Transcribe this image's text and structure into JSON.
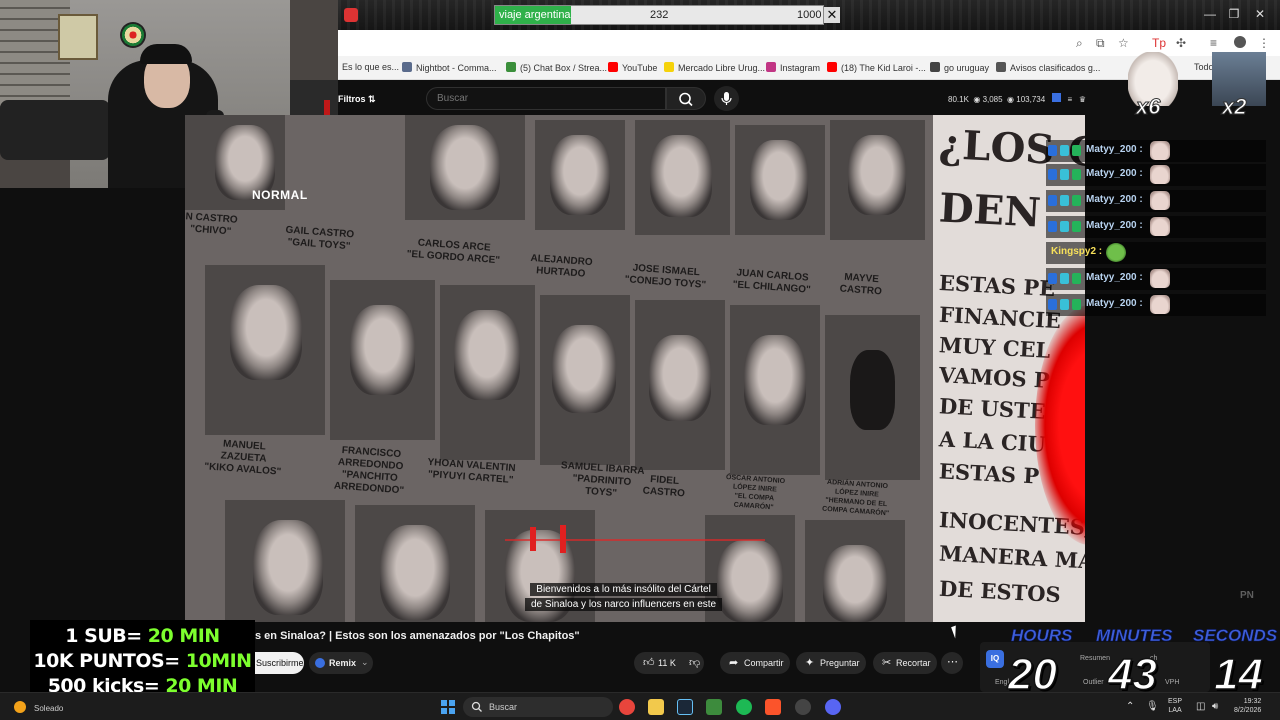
{
  "stream_goal": {
    "title": "viaje argentina",
    "current": "232",
    "target": "1000",
    "progress": 0.232
  },
  "browser": {
    "bookmarks": [
      {
        "label": "Es lo que es...",
        "color": "#888888"
      },
      {
        "label": "Nightbot - Comma...",
        "color": "#5a6b8c"
      },
      {
        "label": "(5) Chat Box / Strea...",
        "color": "#3b8f3b"
      },
      {
        "label": "YouTube",
        "color": "#ff0000"
      },
      {
        "label": "Mercado Libre Urug...",
        "color": "#f5d20a"
      },
      {
        "label": "Instagram",
        "color": "#c13584"
      },
      {
        "label": "(18) The Kid Laroi -...",
        "color": "#ff0000"
      },
      {
        "label": "go uruguay",
        "color": "#444444"
      },
      {
        "label": "Avisos clasificados g...",
        "color": "#555555"
      },
      {
        "label": "Todo",
        "color": "#777777"
      }
    ]
  },
  "youtube": {
    "filters_label": "Filtros",
    "search_placeholder": "Buscar",
    "stats": {
      "views": "80.1K",
      "watching": "3,085",
      "total": "103,734"
    },
    "subtitles": [
      "Bienvenidos a lo más insólito del Cártel",
      "de Sinaloa y los narco influencers en este"
    ],
    "watermark": "PN",
    "title": "s en Sinaloa? | Estos son los amenazados por \"Los Chapitos\"",
    "subscribe_label": "Suscribirme",
    "remix_label": "Remix",
    "likes": "11 K",
    "share_label": "Compartir",
    "ask_label": "Preguntar",
    "clip_label": "Recortar"
  },
  "video_poster": {
    "headline": [
      "¿LOS C",
      "DEN"
    ],
    "lines": [
      "ESTAS PE",
      "FINANCIE",
      "MUY CEL",
      "VAMOS P",
      "DE USTEDE",
      "A LA CIU",
      "ESTAS P",
      "INOCENTES,",
      "MANERA MAS",
      "DE ESTOS"
    ]
  },
  "video_captions": [
    "N CASTRO\n\"CHIVO\"",
    "GAIL CASTRO\n\"GAIL TOYS\"",
    "CARLOS ARCE\n\"EL GORDO ARCE\"",
    "ALEJANDRO\nHURTADO",
    "JOSE ISMAEL\n\"CONEJO TOYS\"",
    "JUAN CARLOS\n\"EL CHILANGO\"",
    "MAYVE\nCASTRO",
    "MANUEL\nZAZUETA\n\"KIKO AVALOS\"",
    "FRANCISCO\nARREDONDO\n\"PANCHITO\nARREDONDO\"",
    "YHOAN VALENTIN\n\"PIYUYI CARTEL\"",
    "SAMUEL IBARRA\n\"PADRINITO\nTOYS\"",
    "FIDEL\nCASTRO",
    "ÓSCAR ANTONIO\nLÓPEZ INIRE\n\"EL COMPA\nCAMARÓN\"",
    "ADRIÁN ANTONIO\nLÓPEZ INIRE\n\"HERMANO DE EL\nCOMPA CAMARÓN\""
  ],
  "webcam": {
    "mode_label": "NORMAL"
  },
  "chat": [
    {
      "user": "Matyy_200 :",
      "color": "#b8d3f0",
      "emote": "cat"
    },
    {
      "user": "Matyy_200 :",
      "color": "#b8d3f0",
      "emote": "cat"
    },
    {
      "user": "Matyy_200 :",
      "color": "#b8d3f0",
      "emote": "cat"
    },
    {
      "user": "Matyy_200 :",
      "color": "#b8d3f0",
      "emote": "cat"
    },
    {
      "user": "Kingspy2 :",
      "color": "#f7e05a",
      "emote": "frog"
    },
    {
      "user": "Matyy_200 :",
      "color": "#b8d3f0",
      "emote": "cat"
    },
    {
      "user": "Matyy_200 :",
      "color": "#b8d3f0",
      "emote": "cat"
    }
  ],
  "alerts": {
    "cat_multiplier": "x6",
    "box_multiplier": "x2"
  },
  "goals": [
    {
      "prefix": "1 SUB= ",
      "highlight": "20 MIN"
    },
    {
      "prefix": "10K PUNTOS= ",
      "highlight": "10MIN"
    },
    {
      "prefix": "500 kicks= ",
      "highlight": "20 MIN"
    }
  ],
  "extension": {
    "logo": "IQ",
    "tabs": [
      "Resumen",
      "ch",
      "Engl",
      "Outlier",
      "VPH"
    ]
  },
  "timer": {
    "hours_label": "HOURS",
    "minutes_label": "MINUTES",
    "seconds_label": "SECONDS",
    "hours": "20",
    "minutes": "43",
    "seconds": "14"
  },
  "taskbar": {
    "weather": "Soleado",
    "search": "Buscar",
    "lang": [
      "ESP",
      "LAA"
    ],
    "time": "19:32",
    "date": "8/2/2026",
    "apps": [
      {
        "name": "chrome-app-icon",
        "color": "#e8453c"
      },
      {
        "name": "folder-app-icon",
        "color": "#f2c94c"
      },
      {
        "name": "steam-app-icon",
        "color": "#1b2838"
      },
      {
        "name": "minecraft-app-icon",
        "color": "#3d8b3d"
      },
      {
        "name": "spotify-app-icon",
        "color": "#1db954"
      },
      {
        "name": "brave-app-icon",
        "color": "#fb542b"
      },
      {
        "name": "obs-app-icon",
        "color": "#444444"
      },
      {
        "name": "discord-app-icon",
        "color": "#5865f2"
      }
    ]
  }
}
